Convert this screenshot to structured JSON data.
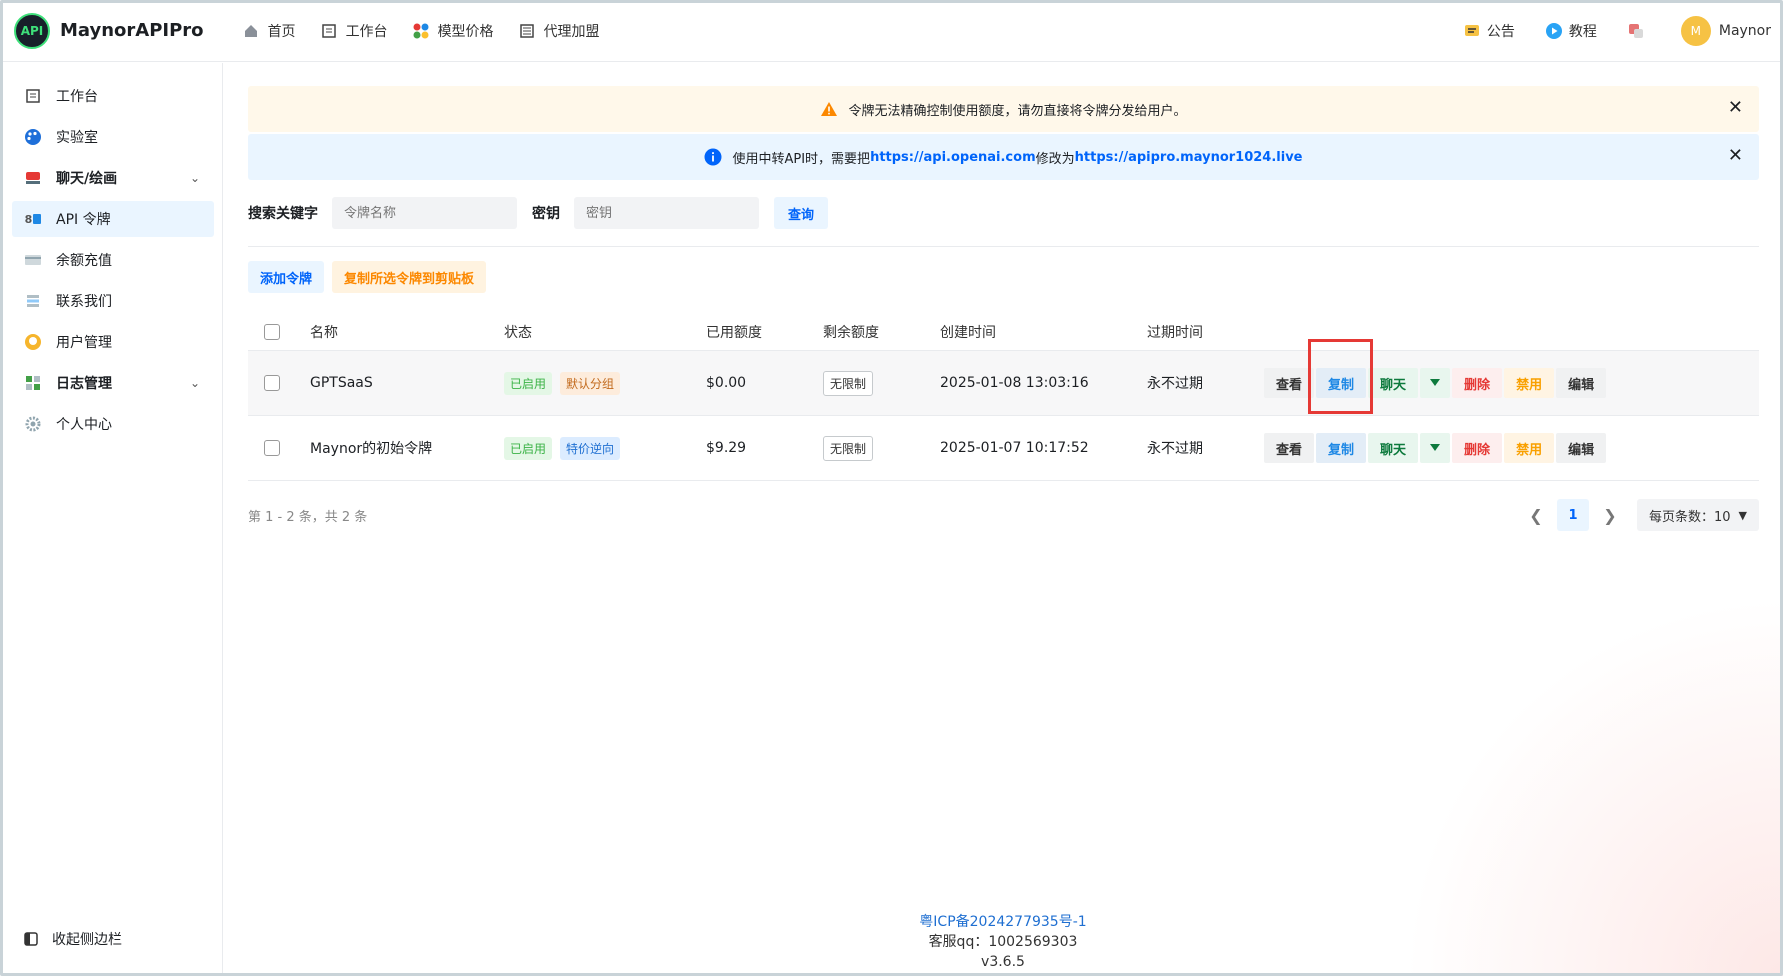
{
  "header": {
    "app_name": "MaynorAPIPro",
    "logo_text": "API",
    "nav": [
      {
        "label": "首页",
        "icon": "home-icon"
      },
      {
        "label": "工作台",
        "icon": "workbench-icon"
      },
      {
        "label": "模型价格",
        "icon": "model-price-icon"
      },
      {
        "label": "代理加盟",
        "icon": "agent-icon"
      }
    ],
    "announcement": "公告",
    "tutorial": "教程",
    "user_initial": "M",
    "user_name": "Maynor"
  },
  "sidebar": {
    "items": [
      {
        "label": "工作台",
        "icon": "workbench-icon"
      },
      {
        "label": "实验室",
        "icon": "palette-icon"
      },
      {
        "label": "聊天/绘画",
        "icon": "chat-paint-icon",
        "expandable": true
      },
      {
        "label": "API 令牌",
        "icon": "api-key-icon",
        "active": true
      },
      {
        "label": "余额充值",
        "icon": "wallet-icon"
      },
      {
        "label": "联系我们",
        "icon": "contact-icon"
      },
      {
        "label": "用户管理",
        "icon": "user-icon"
      },
      {
        "label": "日志管理",
        "icon": "log-icon",
        "expandable": true
      },
      {
        "label": "个人中心",
        "icon": "gear-icon"
      }
    ],
    "collapse_label": "收起侧边栏"
  },
  "banners": {
    "warning": "令牌无法精确控制使用额度，请勿直接将令牌分发给用户。",
    "info_prefix": "使用中转API时，需要把",
    "info_link1": "https://api.openai.com",
    "info_mid": "修改为",
    "info_link2": "https://apipro.maynor1024.live"
  },
  "search": {
    "keyword_label": "搜索关键字",
    "keyword_placeholder": "令牌名称",
    "key_label": "密钥",
    "key_placeholder": "密钥",
    "query_button": "查询"
  },
  "actions": {
    "add_token": "添加令牌",
    "copy_selected": "复制所选令牌到剪贴板"
  },
  "table": {
    "headers": {
      "name": "名称",
      "status": "状态",
      "used": "已用额度",
      "remain": "剩余额度",
      "created": "创建时间",
      "expire": "过期时间"
    },
    "rows": [
      {
        "name": "GPTSaaS",
        "status": "已启用",
        "group": "默认分组",
        "used": "$0.00",
        "remain": "无限制",
        "created": "2025-01-08 13:03:16",
        "expire": "永不过期"
      },
      {
        "name": "Maynor的初始令牌",
        "status": "已启用",
        "group": "特价逆向",
        "used": "$9.29",
        "remain": "无限制",
        "created": "2025-01-07 10:17:52",
        "expire": "永不过期"
      }
    ],
    "ops": {
      "view": "查看",
      "copy": "复制",
      "chat": "聊天",
      "delete": "删除",
      "disable": "禁用",
      "edit": "编辑"
    }
  },
  "pagination": {
    "summary": "第 1 - 2 条，共 2 条",
    "current_page": "1",
    "page_size": "每页条数：10"
  },
  "footer": {
    "icp": "粤ICP备2024277935号-1",
    "qq": "客服qq：1002569303",
    "version": "v3.6.5"
  }
}
